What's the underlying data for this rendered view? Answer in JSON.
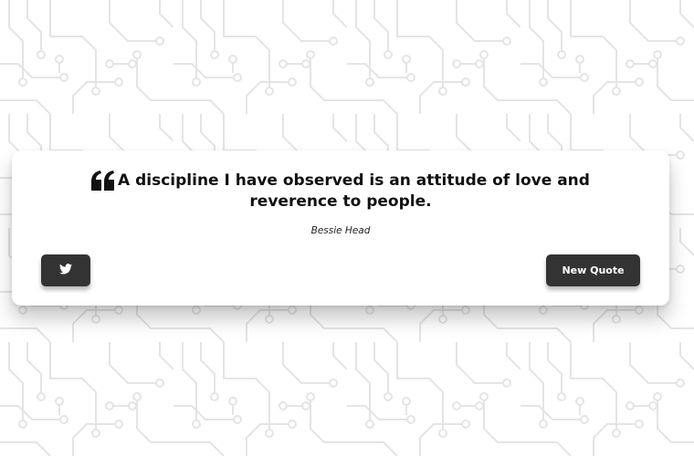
{
  "quote": {
    "text": "A discipline I have observed is an attitude of love and reverence to people.",
    "author": "Bessie Head",
    "quote_icon": "quote-left-icon"
  },
  "actions": {
    "tweet_icon": "twitter-icon",
    "new_quote_label": "New Quote"
  },
  "colors": {
    "background": "#ffffff",
    "circuit_pattern": "#e6e6e6",
    "card": "#ffffff",
    "button": "#333333",
    "button_text": "#ffffff",
    "quote_text": "#111111"
  }
}
